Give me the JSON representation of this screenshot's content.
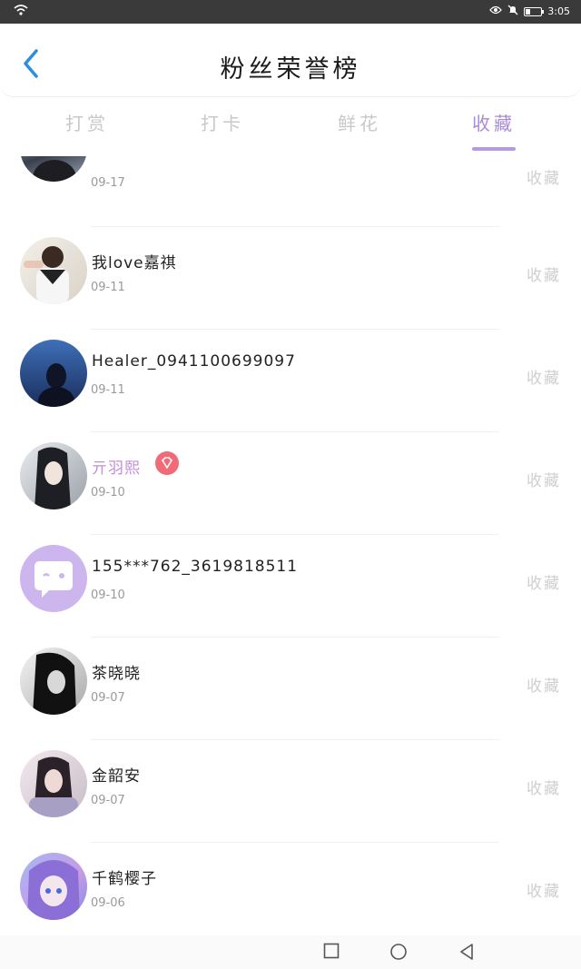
{
  "status_bar": {
    "time": "3:05"
  },
  "header": {
    "title": "粉丝荣誉榜"
  },
  "tabs": [
    {
      "label": "打赏",
      "active": false
    },
    {
      "label": "打卡",
      "active": false
    },
    {
      "label": "鲜花",
      "active": false
    },
    {
      "label": "收藏",
      "active": true
    }
  ],
  "accent_color": "#a98ad6",
  "list": {
    "action_label": "收藏",
    "items": [
      {
        "name": "",
        "date": "09-17",
        "vip": false
      },
      {
        "name": "我love嘉祺",
        "date": "09-11",
        "vip": false
      },
      {
        "name": "Healer_0941100699097",
        "date": "09-11",
        "vip": false
      },
      {
        "name": "亓羽熙",
        "date": "09-10",
        "vip": true
      },
      {
        "name": "155***762_3619818511",
        "date": "09-10",
        "vip": false
      },
      {
        "name": "茶晓晓",
        "date": "09-07",
        "vip": false
      },
      {
        "name": "金韶安",
        "date": "09-07",
        "vip": false
      },
      {
        "name": "千鹤樱子",
        "date": "09-06",
        "vip": false
      }
    ]
  },
  "nav": {
    "recent_icon": "square-icon",
    "home_icon": "circle-icon",
    "back_icon": "triangle-back-icon"
  }
}
